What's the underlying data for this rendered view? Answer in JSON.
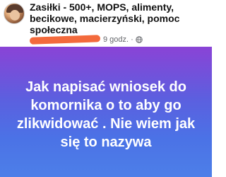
{
  "post": {
    "group_name": "Zasiłki - 500+, MOPS, alimenty, becikowe, macierzyński, pomoc społeczna",
    "time": "9 godz.",
    "separator": "·",
    "privacy_icon": "globe-icon",
    "body": "Jak napisać wniosek do komornika o to aby go zlikwidować . Nie wiem jak się to nazywa"
  },
  "colors": {
    "background_gradient_top": "#8a43d6",
    "background_gradient_bottom": "#4d7fe8",
    "redaction": "#f36a3c"
  }
}
